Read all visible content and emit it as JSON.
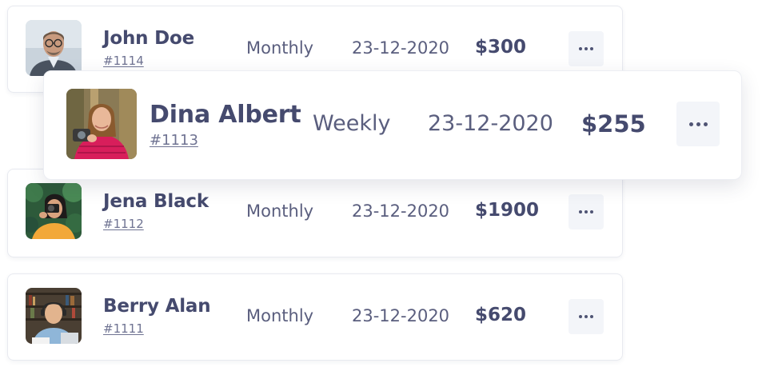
{
  "transactions": [
    {
      "name": "John Doe",
      "order_id": "#1114",
      "frequency": "Monthly",
      "date": "23-12-2020",
      "amount": "$300",
      "more_label": "More options"
    },
    {
      "name": "Dina Albert",
      "order_id": "#1113",
      "frequency": "Weekly",
      "date": "23-12-2020",
      "amount": "$255",
      "more_label": "More options"
    },
    {
      "name": "Jena Black",
      "order_id": "#1112",
      "frequency": "Monthly",
      "date": "23-12-2020",
      "amount": "$1900",
      "more_label": "More options"
    },
    {
      "name": "Berry Alan",
      "order_id": "#1111",
      "frequency": "Monthly",
      "date": "23-12-2020",
      "amount": "$620",
      "more_label": "More options"
    }
  ],
  "colors": {
    "text_primary": "#454a6e",
    "text_secondary": "#5a5e7e",
    "button_bg": "#f3f5f9",
    "card_border": "#e8eaf0"
  }
}
